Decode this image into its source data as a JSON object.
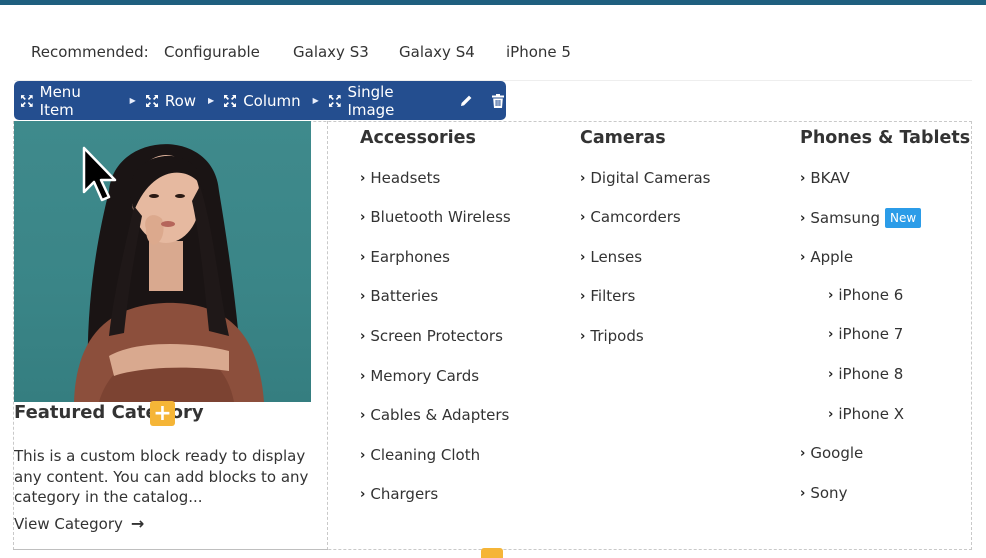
{
  "recommended": {
    "label": "Recommended:",
    "links": [
      "Configurable",
      "Galaxy S3",
      "Galaxy S4",
      "iPhone 5"
    ]
  },
  "toolbar": {
    "items": [
      "Menu Item",
      "Row",
      "Column",
      "Single Image"
    ],
    "edit_icon": "pencil-icon",
    "delete_icon": "trash-icon"
  },
  "featured": {
    "title": "Featured Category",
    "description": "This is a custom block ready to display any content. You can add blocks to any category in the catalog...",
    "link": "View Category"
  },
  "columns": [
    {
      "title": "Accessories",
      "items": [
        "Headsets",
        "Bluetooth Wireless",
        "Earphones",
        "Batteries",
        "Screen Protectors",
        "Memory Cards",
        "Cables & Adapters",
        "Cleaning Cloth",
        "Chargers"
      ]
    },
    {
      "title": "Cameras",
      "items": [
        "Digital Cameras",
        "Camcorders",
        "Lenses",
        "Filters",
        "Tripods"
      ]
    },
    {
      "title": "Phones & Tablets",
      "items": [
        {
          "label": "BKAV"
        },
        {
          "label": "Samsung",
          "badge": "New"
        },
        {
          "label": "Apple"
        },
        {
          "label": "iPhone 6",
          "sub": true
        },
        {
          "label": "iPhone 7",
          "sub": true
        },
        {
          "label": "iPhone 8",
          "sub": true
        },
        {
          "label": "iPhone X",
          "sub": true
        },
        {
          "label": "Google"
        },
        {
          "label": "Sony"
        }
      ]
    }
  ],
  "colors": {
    "toolbar_bg": "#244e8f",
    "top_bar": "#1f5f7f",
    "new_badge": "#2b9ce8",
    "add_badge": "#f5b537"
  }
}
